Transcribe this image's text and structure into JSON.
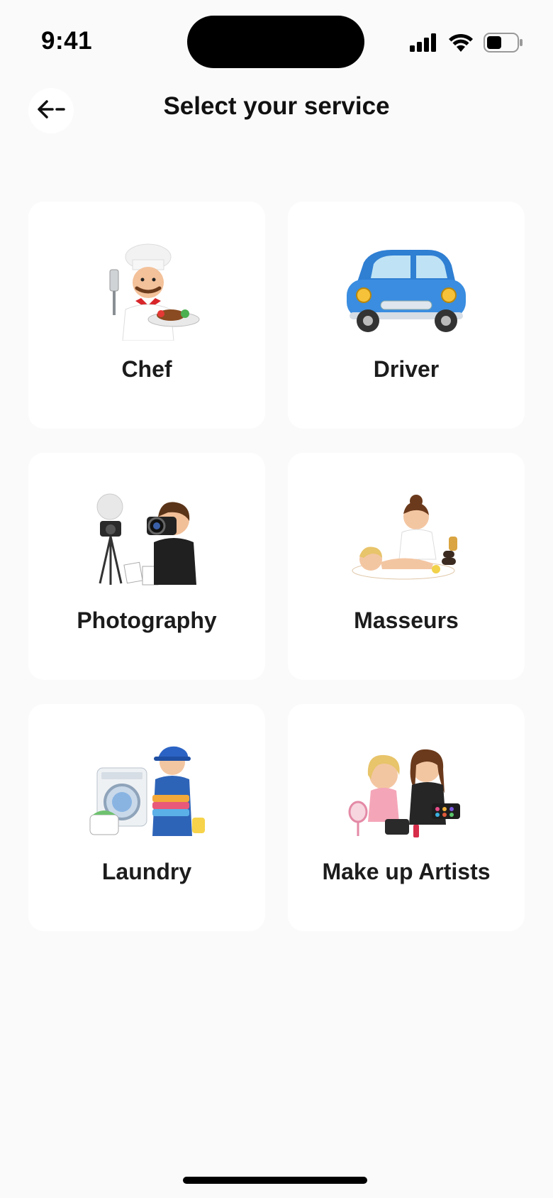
{
  "status_bar": {
    "time": "9:41",
    "icons": [
      "cellular-signal-icon",
      "wifi-icon",
      "battery-icon"
    ]
  },
  "header": {
    "back_icon": "arrow-left-icon",
    "title": "Select your service"
  },
  "services": [
    {
      "label": "Chef",
      "icon": "chef-illustration"
    },
    {
      "label": "Driver",
      "icon": "car-illustration"
    },
    {
      "label": "Photography",
      "icon": "photographer-illustration"
    },
    {
      "label": "Masseurs",
      "icon": "massage-illustration"
    },
    {
      "label": "Laundry",
      "icon": "laundry-illustration"
    },
    {
      "label": "Make up Artists",
      "icon": "makeup-artist-illustration"
    }
  ],
  "colors": {
    "background": "#fafafa",
    "card": "#ffffff",
    "text": "#1a1a1a"
  }
}
